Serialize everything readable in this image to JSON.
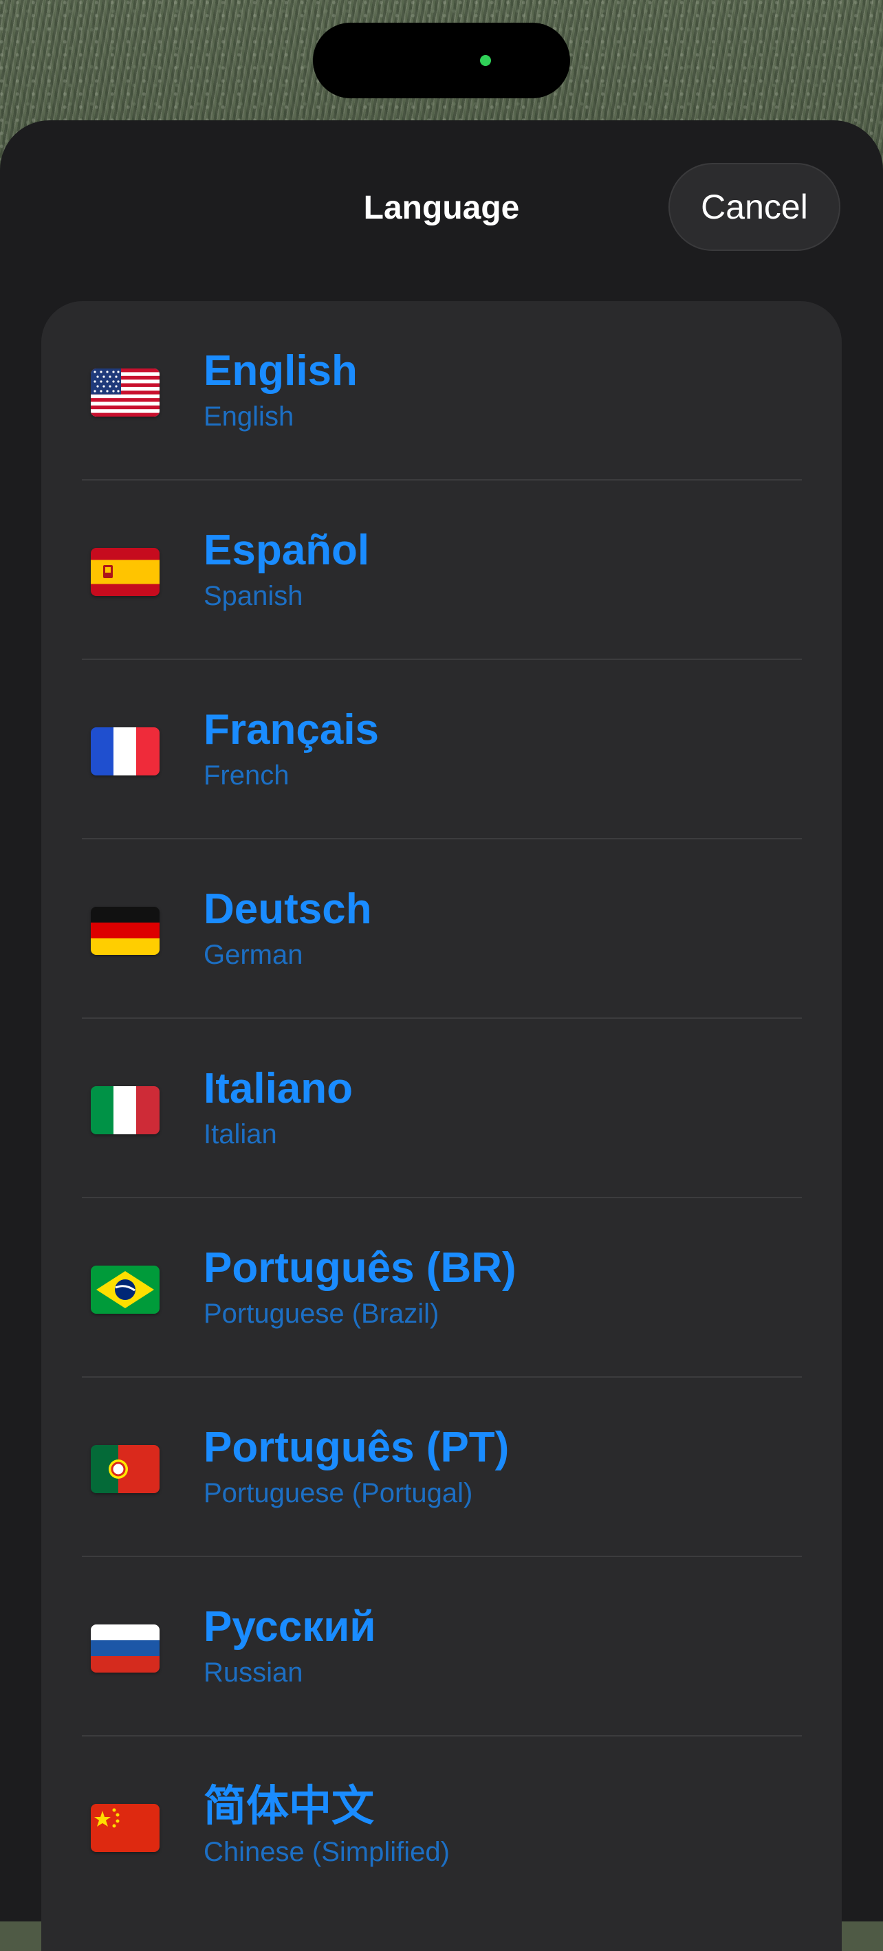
{
  "sheet": {
    "title": "Language",
    "cancel_label": "Cancel"
  },
  "languages": [
    {
      "native": "English",
      "english": "English",
      "flag": "flag-us-icon"
    },
    {
      "native": "Español",
      "english": "Spanish",
      "flag": "flag-es-icon"
    },
    {
      "native": "Français",
      "english": "French",
      "flag": "flag-fr-icon"
    },
    {
      "native": "Deutsch",
      "english": "German",
      "flag": "flag-de-icon"
    },
    {
      "native": "Italiano",
      "english": "Italian",
      "flag": "flag-it-icon"
    },
    {
      "native": "Português (BR)",
      "english": "Portuguese (Brazil)",
      "flag": "flag-br-icon"
    },
    {
      "native": "Português (PT)",
      "english": "Portuguese (Portugal)",
      "flag": "flag-pt-icon"
    },
    {
      "native": "Русский",
      "english": "Russian",
      "flag": "flag-ru-icon"
    },
    {
      "native": "简体中文",
      "english": "Chinese (Simplified)",
      "flag": "flag-cn-icon"
    }
  ],
  "colors": {
    "accent": "#1a8cff",
    "secondary_accent": "#1c6fc4",
    "sheet_background": "#1c1c1e",
    "list_background": "#2a2a2c",
    "camera_indicator": "#30d158"
  }
}
